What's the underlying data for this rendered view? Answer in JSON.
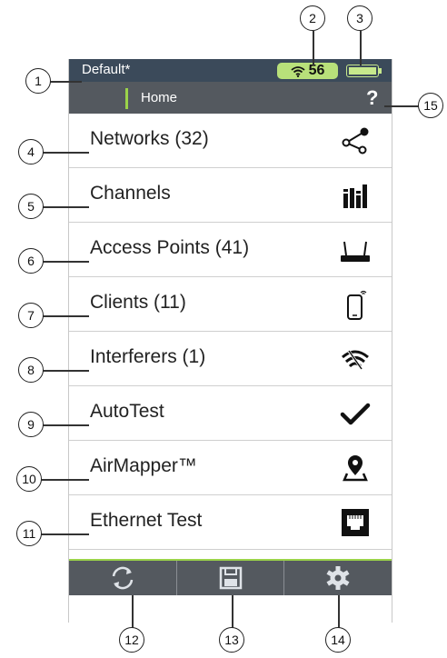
{
  "status": {
    "profile": "Default*",
    "signal_count": "56",
    "battery_icon": "battery-icon"
  },
  "nav": {
    "title": "Home",
    "help": "?"
  },
  "menu": [
    {
      "label": "Networks (32)",
      "icon": "share-icon"
    },
    {
      "label": "Channels",
      "icon": "bar-chart-icon"
    },
    {
      "label": "Access Points (41)",
      "icon": "router-icon"
    },
    {
      "label": "Clients (11)",
      "icon": "phone-icon"
    },
    {
      "label": "Interferers (1)",
      "icon": "interference-icon"
    },
    {
      "label": "AutoTest",
      "icon": "checkmark-icon"
    },
    {
      "label": "AirMapper™",
      "icon": "map-pin-icon"
    },
    {
      "label": "Ethernet Test",
      "icon": "ethernet-port-icon"
    }
  ],
  "bottom": [
    {
      "icon": "refresh-icon"
    },
    {
      "icon": "save-icon"
    },
    {
      "icon": "gear-icon"
    }
  ],
  "callouts": [
    "1",
    "2",
    "3",
    "4",
    "5",
    "6",
    "7",
    "8",
    "9",
    "10",
    "11",
    "12",
    "13",
    "14",
    "15"
  ],
  "colors": {
    "accent": "#9bd34a",
    "statusbar": "#3b4a5a",
    "navbar": "#54595f",
    "signal_bg": "#b8e07a"
  }
}
